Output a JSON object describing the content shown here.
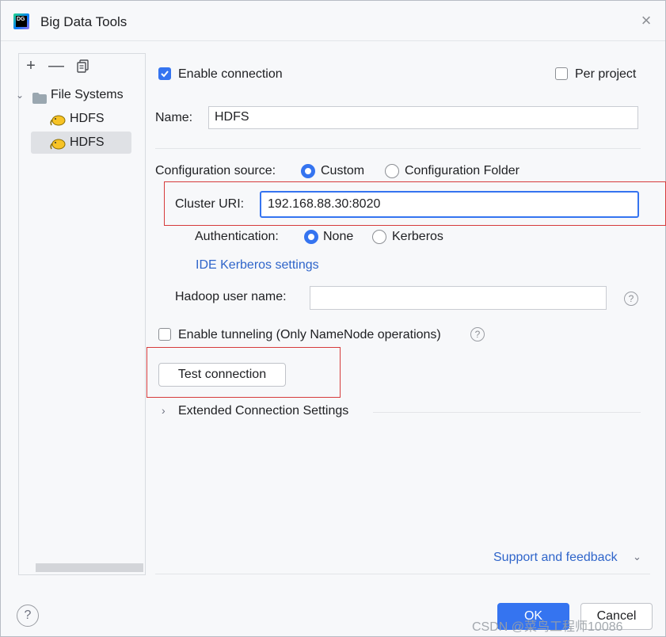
{
  "window": {
    "title": "Big Data Tools",
    "logo_text": "DG"
  },
  "toolbar": {
    "add_icon": "+",
    "remove_icon": "—",
    "copy_icon": "copy-icon"
  },
  "tree": {
    "group_label": "File Systems",
    "items": [
      {
        "label": "HDFS",
        "selected": false
      },
      {
        "label": "HDFS",
        "selected": true
      }
    ]
  },
  "form": {
    "enable_connection_label": "Enable connection",
    "enable_connection_checked": true,
    "per_project_label": "Per project",
    "per_project_checked": false,
    "name_label": "Name:",
    "name_value": "HDFS",
    "config_source_label": "Configuration source:",
    "config_options": [
      "Custom",
      "Configuration Folder"
    ],
    "config_selected": "Custom",
    "cluster_uri_label": "Cluster URI:",
    "cluster_uri_value": "192.168.88.30:8020",
    "auth_label": "Authentication:",
    "auth_options": [
      "None",
      "Kerberos"
    ],
    "auth_selected": "None",
    "kerberos_link": "IDE Kerberos settings",
    "hadoop_user_label": "Hadoop user name:",
    "hadoop_user_value": "",
    "tunneling_label": "Enable tunneling (Only NameNode operations)",
    "tunneling_checked": false,
    "test_connection_label": "Test connection",
    "extended_label": "Extended Connection Settings",
    "support_link": "Support and feedback"
  },
  "footer": {
    "help": "?",
    "ok_label": "OK",
    "cancel_label": "Cancel",
    "watermark": "CSDN @菜鸟工程师10086"
  },
  "colors": {
    "accent": "#3574f0",
    "highlight_box": "#d63b3b",
    "link": "#2f65ca"
  }
}
